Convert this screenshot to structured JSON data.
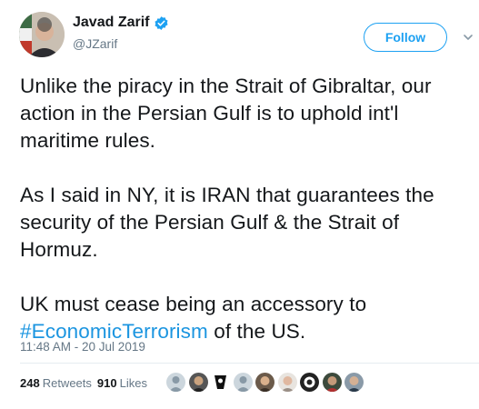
{
  "author": {
    "name": "Javad Zarif",
    "handle": "@JZarif",
    "verified": true
  },
  "follow_label": "Follow",
  "tweet": {
    "paragraphs": [
      "Unlike the piracy in the Strait of Gibraltar, our action in the Persian Gulf is to uphold int'l maritime rules.",
      "As I said in NY, it is IRAN that guarantees the security of the Persian Gulf & the Strait of Hormuz."
    ],
    "last_paragraph_before": "UK must cease being an accessory to ",
    "hashtag": "#EconomicTerrorism",
    "last_paragraph_after": " of the US."
  },
  "timestamp": "11:48 AM - 20 Jul 2019",
  "stats": {
    "retweets_count": "248",
    "retweets_label": "Retweets",
    "likes_count": "910",
    "likes_label": "Likes"
  },
  "likers_count_shown": 9,
  "colors": {
    "accent": "#1da1f2",
    "hashtag": "#1b95e0",
    "secondary_text": "#657786"
  },
  "icons": [
    "verified-badge-icon",
    "chevron-down-icon"
  ]
}
